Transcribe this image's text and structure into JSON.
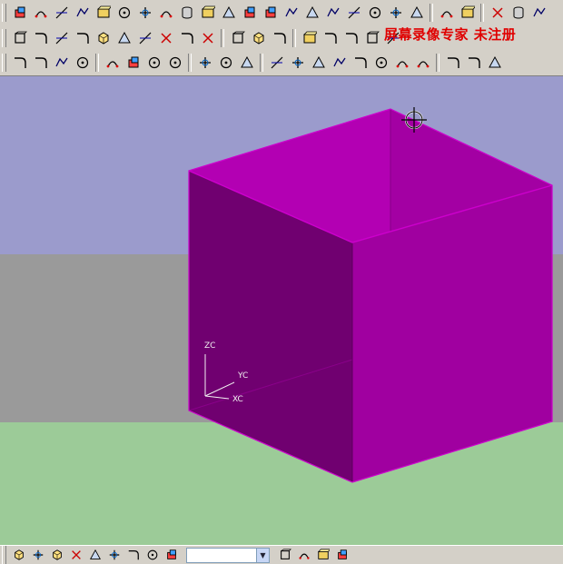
{
  "watermark": "屏幕录像专家 未注册",
  "toolbars": {
    "row1": [
      "point-tool",
      "curve-through-points-tool",
      "fillet-tool",
      "rectangle-tool",
      "circle-tool",
      "circle-center-tool",
      "cone-surface-tool",
      "face-tool",
      "transform-tool",
      "edit-curve-tool",
      "joint-tool",
      "mirror-tool",
      "offset-curve-tool",
      "trim-tool",
      "extract-geometry-tool",
      "curve-parameters-tool",
      "divide-curve-tool",
      "section-tool",
      "sketch-tool",
      "measure-tool",
      "snap-tool",
      "grid-tool",
      "sweep-tool",
      "analysis-tool",
      "close-tool"
    ],
    "row2": [
      "sketch-plane-tool",
      "hole-tool",
      "pocket-tool",
      "pad-tool",
      "boss-tool",
      "cylinder-stack-tool",
      "slot-tool",
      "groove-tool",
      "chamfer-tool",
      "shell-tool",
      "extrude-tool",
      "revolve-tool",
      "block-tool",
      "cylinder-tool",
      "cone-tool",
      "edge-blend-tool",
      "hide-tool",
      "color-tool"
    ],
    "row3": [
      "orient-view-tool",
      "zoom-tool",
      "pan-tool",
      "layer-settings-tool",
      "render-style-tool",
      "wireframe-tool",
      "shaded-tool",
      "hidden-edges-tool",
      "datum-plane-tool",
      "mirror-body-tool",
      "unite-tool",
      "subtract-tool",
      "intersect-tool",
      "shade-cube-tool",
      "blend-cube-tool",
      "face-blend-tool",
      "cube-wireframe-tool",
      "section-view-tool",
      "light-tool",
      "material-tool",
      "visual-effects-tool",
      "render-tool"
    ]
  },
  "viewport": {
    "background_top": "#9b9bcc",
    "background_middle": "#9a9a9a",
    "background_bottom": "#9ccb98",
    "block_color": "#cc00cc",
    "triad_labels": {
      "zc": "ZC",
      "yc": "YC",
      "xc": "XC"
    }
  },
  "statusbar": {
    "tools": [
      "orient-csys-tool",
      "view-settings-tool",
      "snap-point-tool",
      "snap-endpoint-tool",
      "snap-midpoint-tool",
      "snap-center-tool",
      "snap-quadrant-tool",
      "snap-intersection-tool",
      "snap-existing-point-tool"
    ],
    "filter_value": "",
    "tools_right": [
      "selection-filter-tool",
      "select-face-tool",
      "select-body-tool",
      "select-feature-tool"
    ]
  }
}
